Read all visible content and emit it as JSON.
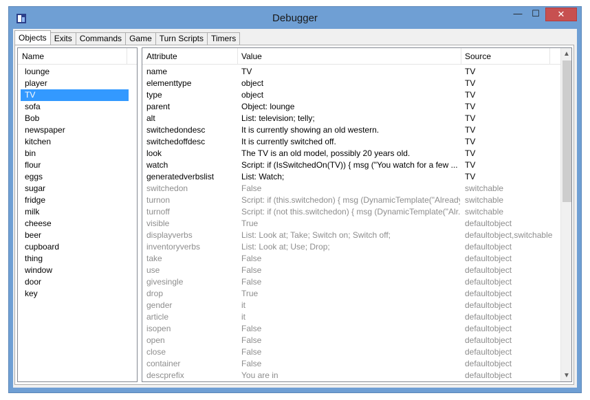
{
  "window": {
    "title": "Debugger",
    "minimize_glyph": "—",
    "maximize_glyph": "☐",
    "close_glyph": "✕"
  },
  "tabs": [
    {
      "label": "Objects",
      "active": true
    },
    {
      "label": "Exits"
    },
    {
      "label": "Commands"
    },
    {
      "label": "Game"
    },
    {
      "label": "Turn Scripts"
    },
    {
      "label": "Timers"
    }
  ],
  "objects_list": {
    "header": "Name",
    "selected": "TV",
    "items": [
      "lounge",
      "player",
      "TV",
      "sofa",
      "Bob",
      "newspaper",
      "kitchen",
      "bin",
      "flour",
      "eggs",
      "sugar",
      "fridge",
      "milk",
      "cheese",
      "beer",
      "cupboard",
      "thing",
      "window",
      "door",
      "key"
    ]
  },
  "attributes_table": {
    "headers": {
      "attribute": "Attribute",
      "value": "Value",
      "source": "Source"
    },
    "rows": [
      {
        "attribute": "name",
        "value": "TV",
        "source": "TV",
        "inherited": false
      },
      {
        "attribute": "elementtype",
        "value": "object",
        "source": "TV",
        "inherited": false
      },
      {
        "attribute": "type",
        "value": "object",
        "source": "TV",
        "inherited": false
      },
      {
        "attribute": "parent",
        "value": "Object: lounge",
        "source": "TV",
        "inherited": false
      },
      {
        "attribute": "alt",
        "value": "List: television; telly;",
        "source": "TV",
        "inherited": false
      },
      {
        "attribute": "switchedondesc",
        "value": "It is currently showing an old western.",
        "source": "TV",
        "inherited": false
      },
      {
        "attribute": "switchedoffdesc",
        "value": "It is currently switched off.",
        "source": "TV",
        "inherited": false
      },
      {
        "attribute": "look",
        "value": "The TV is an old model, possibly 20 years old.",
        "source": "TV",
        "inherited": false
      },
      {
        "attribute": "watch",
        "value": "Script: if (IsSwitchedOn(TV)) {          msg (\"You watch for a few ...",
        "source": "TV",
        "inherited": false
      },
      {
        "attribute": "generatedverbslist",
        "value": "List: Watch;",
        "source": "TV",
        "inherited": false
      },
      {
        "attribute": "switchedon",
        "value": "False",
        "source": "switchable",
        "inherited": true
      },
      {
        "attribute": "turnon",
        "value": "Script: if (this.switchedon) {       msg (DynamicTemplate(\"Already...",
        "source": "switchable",
        "inherited": true
      },
      {
        "attribute": "turnoff",
        "value": "Script: if (not this.switchedon) {       msg (DynamicTemplate(\"Alr...",
        "source": "switchable",
        "inherited": true
      },
      {
        "attribute": "visible",
        "value": "True",
        "source": "defaultobject",
        "inherited": true
      },
      {
        "attribute": "displayverbs",
        "value": "List: Look at; Take; Switch on; Switch off;",
        "source": "defaultobject,switchable",
        "inherited": true
      },
      {
        "attribute": "inventoryverbs",
        "value": "List: Look at; Use; Drop;",
        "source": "defaultobject",
        "inherited": true
      },
      {
        "attribute": "take",
        "value": "False",
        "source": "defaultobject",
        "inherited": true
      },
      {
        "attribute": "use",
        "value": "False",
        "source": "defaultobject",
        "inherited": true
      },
      {
        "attribute": "givesingle",
        "value": "False",
        "source": "defaultobject",
        "inherited": true
      },
      {
        "attribute": "drop",
        "value": "True",
        "source": "defaultobject",
        "inherited": true
      },
      {
        "attribute": "gender",
        "value": "it",
        "source": "defaultobject",
        "inherited": true
      },
      {
        "attribute": "article",
        "value": "it",
        "source": "defaultobject",
        "inherited": true
      },
      {
        "attribute": "isopen",
        "value": "False",
        "source": "defaultobject",
        "inherited": true
      },
      {
        "attribute": "open",
        "value": "False",
        "source": "defaultobject",
        "inherited": true
      },
      {
        "attribute": "close",
        "value": "False",
        "source": "defaultobject",
        "inherited": true
      },
      {
        "attribute": "container",
        "value": "False",
        "source": "defaultobject",
        "inherited": true
      },
      {
        "attribute": "descprefix",
        "value": "You are in",
        "source": "defaultobject",
        "inherited": true
      }
    ]
  },
  "scrollbar": {
    "up_glyph": "▲",
    "down_glyph": "▼",
    "position_fraction": 0.0
  },
  "colors": {
    "selection": "#3399ff",
    "inherited_text": "#8d8d8d",
    "window_frame": "#6f9fd4",
    "close_button": "#c75050"
  },
  "icons": {
    "app": "debugger-app-icon"
  }
}
